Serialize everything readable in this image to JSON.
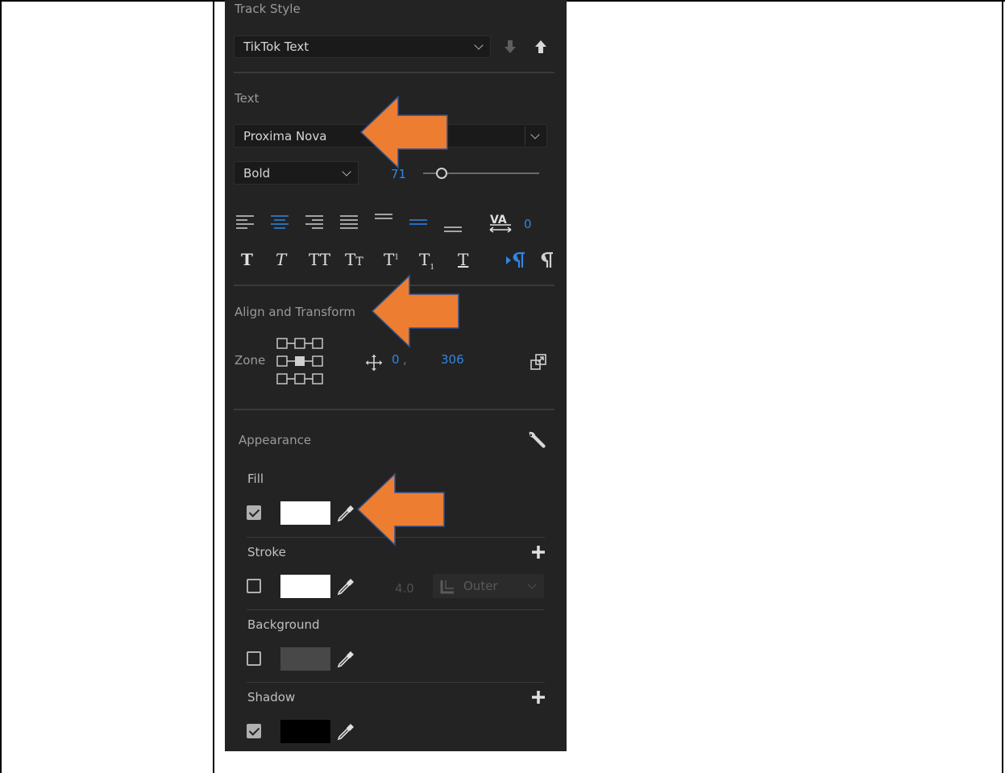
{
  "track_style": {
    "label": "Track Style",
    "selected": "TikTok Text"
  },
  "text": {
    "label": "Text",
    "font": "Proxima Nova",
    "weight": "Bold",
    "size": "71",
    "kerning": "0"
  },
  "align_transform": {
    "label": "Align and Transform",
    "zone_label": "Zone",
    "pos_x": "0",
    "pos_sep": ",",
    "pos_y": "306"
  },
  "appearance": {
    "label": "Appearance",
    "fill": {
      "label": "Fill",
      "checked": true,
      "color": "#ffffff"
    },
    "stroke": {
      "label": "Stroke",
      "checked": false,
      "color": "#ffffff",
      "width": "4.0",
      "type": "Outer"
    },
    "background": {
      "label": "Background",
      "checked": false,
      "color": "#4a4a4a"
    },
    "shadow": {
      "label": "Shadow",
      "checked": true,
      "color": "#000000"
    }
  },
  "colors": {
    "panel_bg": "#232323",
    "accent_blue": "#2e86e6",
    "annotation_arrow": "#ed7d31",
    "annotation_arrow_border": "#2f528f"
  },
  "icons": [
    "chevron-down-icon",
    "arrow-down-icon",
    "arrow-up-icon",
    "slider-icon",
    "align-left-icon",
    "align-center-icon",
    "align-right-icon",
    "justify-icon",
    "align-top-icon",
    "align-middle-icon",
    "align-bottom-icon",
    "tracking-icon",
    "bold-icon",
    "italic-icon",
    "all-caps-icon",
    "small-caps-icon",
    "superscript-icon",
    "subscript-icon",
    "underline-icon",
    "ltr-paragraph-icon",
    "rtl-paragraph-icon",
    "zone-grid-icon",
    "move-icon",
    "reset-transform-icon",
    "wrench-icon",
    "pipette-icon",
    "plus-icon",
    "stroke-join-icon",
    "checkbox-icon"
  ]
}
